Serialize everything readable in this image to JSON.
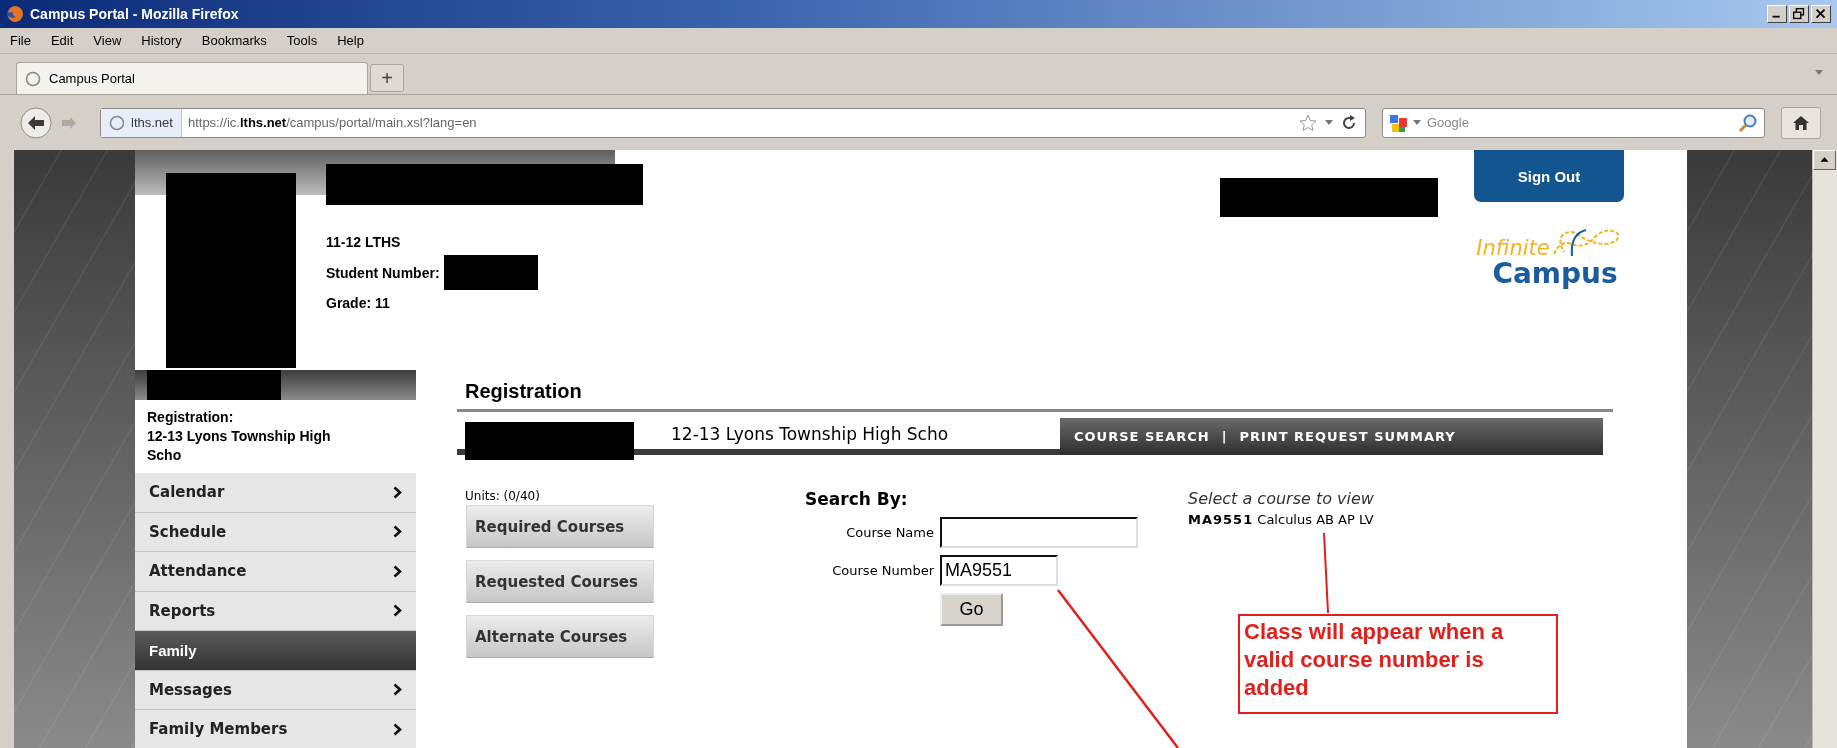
{
  "window": {
    "title": "Campus Portal - Mozilla Firefox"
  },
  "menu_bar": [
    "File",
    "Edit",
    "View",
    "History",
    "Bookmarks",
    "Tools",
    "Help"
  ],
  "tabs": [
    {
      "label": "Campus Portal",
      "selected": true
    }
  ],
  "new_tab": "+",
  "address_bar": {
    "site": "lths.net",
    "url": "https://ic.**lths.net**/campus/portal/main.xsl?lang=en"
  },
  "search_box": {
    "placeholder": "Google"
  },
  "header": {
    "school_year": "11-12 LTHS",
    "student_number_label": "Student Number:",
    "grade": "Grade: 11",
    "sign_out": "Sign Out",
    "logo": {
      "line_1": "Infinite",
      "line_2": "Campus"
    }
  },
  "sidebar": {
    "context_label": "Registration:",
    "context_value": "12-13 Lyons Township High Scho",
    "items": [
      {
        "label": "Calendar",
        "kind": "link"
      },
      {
        "label": "Schedule",
        "kind": "link"
      },
      {
        "label": "Attendance",
        "kind": "link"
      },
      {
        "label": "Reports",
        "kind": "link"
      },
      {
        "label": "Family",
        "kind": "header"
      },
      {
        "label": "Messages",
        "kind": "link"
      },
      {
        "label": "Family Members",
        "kind": "link"
      }
    ]
  },
  "registration": {
    "title": "Registration",
    "school": "12-13 Lyons Township High Scho",
    "nav_links": [
      "COURSE SEARCH",
      "PRINT REQUEST SUMMARY"
    ],
    "nav_separator": "|",
    "units": "Units: (0/40)",
    "course_lists": [
      "Required Courses",
      "Requested Courses",
      "Alternate Courses"
    ],
    "search": {
      "title": "Search By:",
      "fields": [
        {
          "label": "Course Name"
        },
        {
          "label": "Course Number",
          "value": "MA9551"
        }
      ],
      "go_button": "Go"
    },
    "result": {
      "prompt": "Select a course to view",
      "course_code": "MA9551",
      "course_name": "Calculus AB AP LV"
    }
  },
  "annotation": {
    "text": "Class will appear when a valid course number is added"
  }
}
